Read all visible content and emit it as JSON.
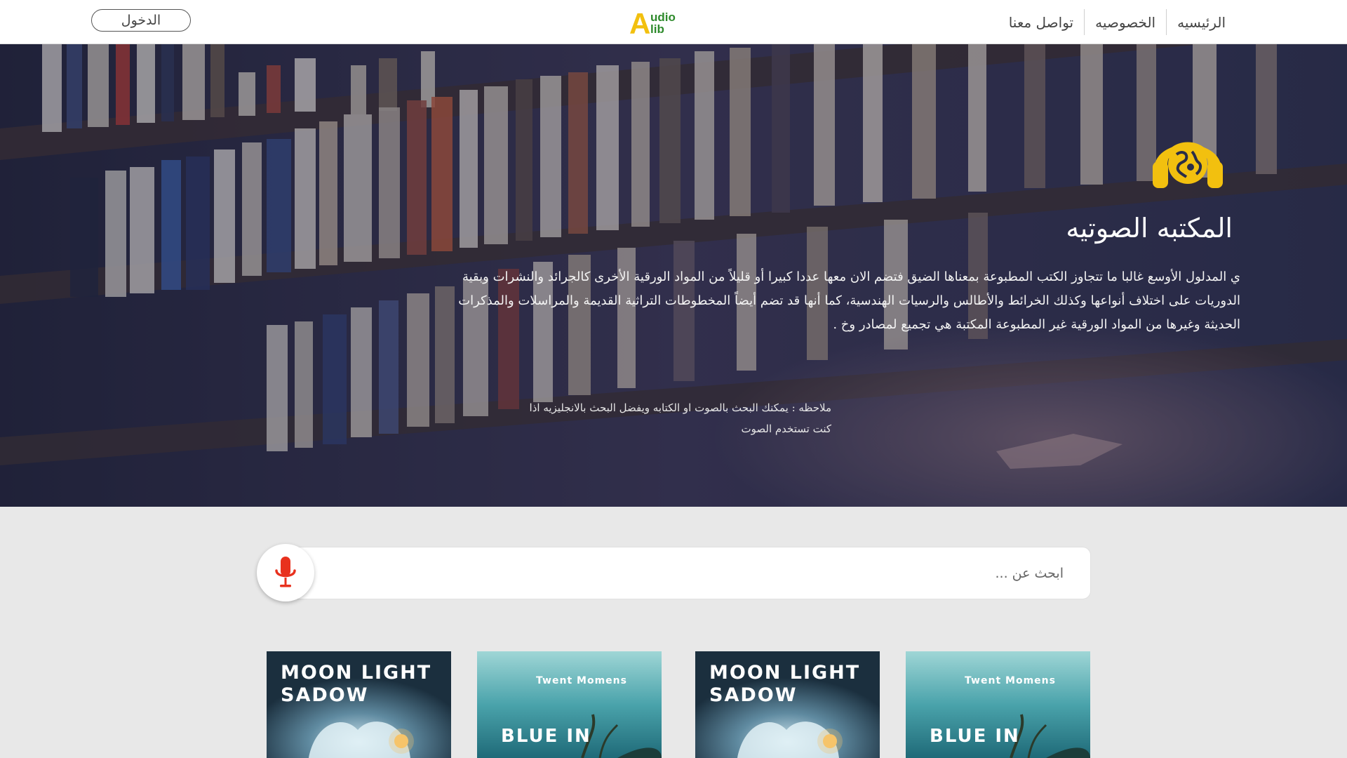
{
  "nav": {
    "login": "الدخول",
    "logo_letter": "A",
    "logo_line1": "udio",
    "logo_line2": "lib",
    "links": [
      "الرئيسيه",
      "الخصوصيه",
      "تواصل معنا"
    ]
  },
  "hero": {
    "icon": "headphone-globe-icon",
    "title": "المكتبه الصوتيه",
    "description": "ي المدلول الأوسع غالبا ما تتجاوز الكتب المطبوعة بمعناها الضيق فتضم الان معها عددا كبيرا أو قليلاً من المواد الورقية الأخرى كالجرائد والنشرات وبقية الدوريات على اختلاف أنواعها وكذلك الخرائط والأطالس والرسيات الهندسية، كما أنها قد تضم أيضاً المخطوطات التراثية القديمة والمراسلات والمذكرات الحديثة وغيرها من المواد الورقية غير المطبوعة المكتبة هي تجميع لمصادر وخ .",
    "note": "ملاحظه : يمكنك البحث بالصوت او الكتابه ويفضل البحث بالانجليزيه اذا كنت تستخدم الصوت"
  },
  "search": {
    "placeholder": "ابحث عن ...",
    "mic_icon": "microphone-icon"
  },
  "cards": [
    {
      "title": "MOON LIGHT SADOW"
    },
    {
      "subtitle": "Twent Momens",
      "title": "BLUE IN"
    },
    {
      "title": "MOON LIGHT SADOW"
    },
    {
      "subtitle": "Twent Momens",
      "title": "BLUE IN"
    }
  ],
  "colors": {
    "accent_yellow": "#f2c00f",
    "logo_green": "#2e8a2c",
    "mic_red": "#e8311e",
    "page_bg": "#e8e8e8"
  }
}
